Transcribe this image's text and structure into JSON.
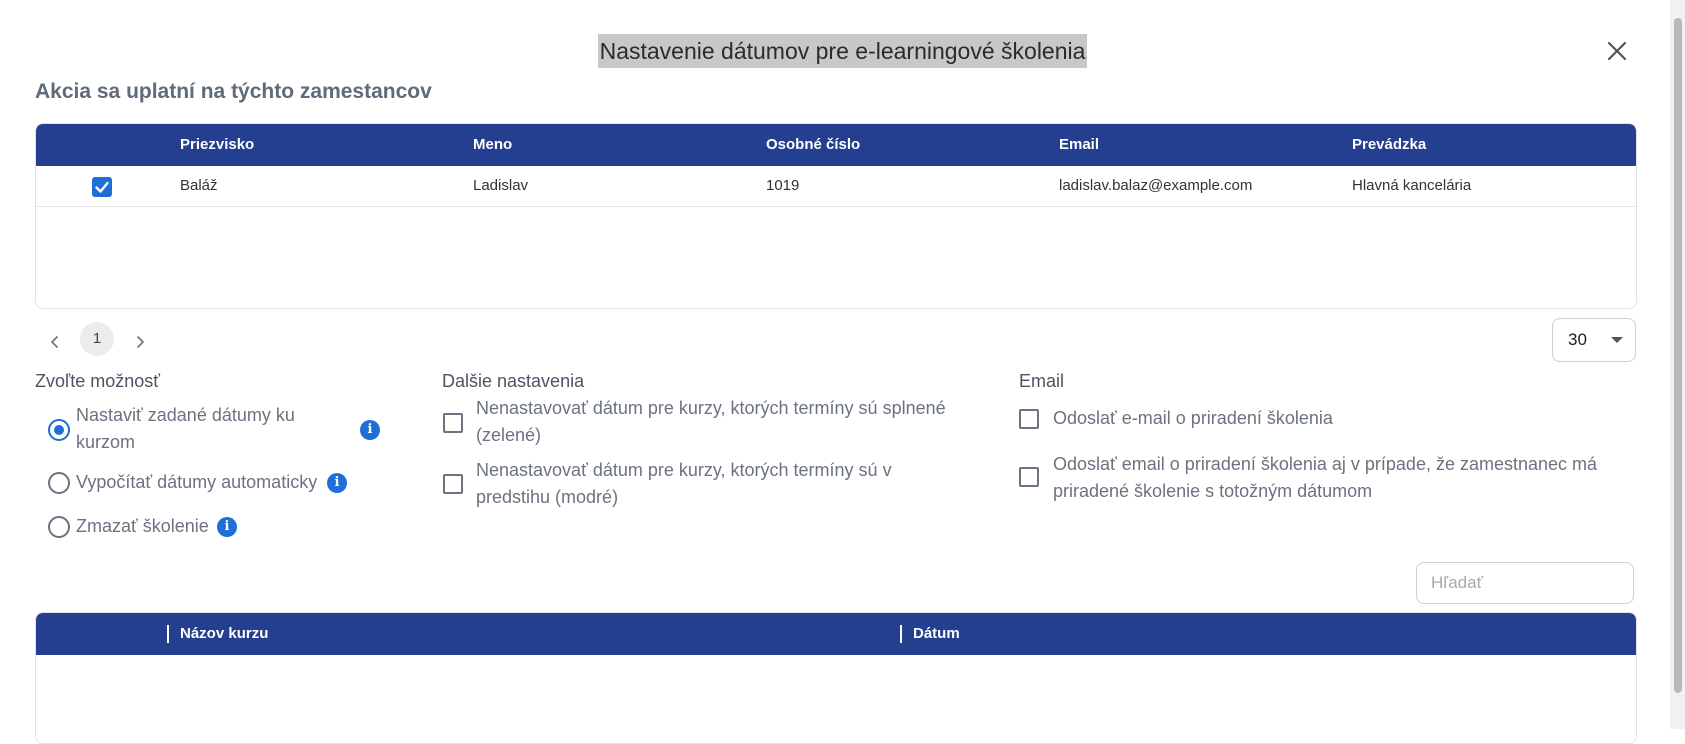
{
  "dialog": {
    "title": "Nastavenie dátumov pre e-learningové školenia",
    "subtitle": "Akcia sa uplatní na týchto zamestancov"
  },
  "employees": {
    "columns": [
      "Priezvisko",
      "Meno",
      "Osobné číslo",
      "Email",
      "Prevádzka"
    ],
    "rows": [
      {
        "checked": true,
        "surname": "Baláž",
        "name": "Ladislav",
        "personal_number": "1019",
        "email": "ladislav.balaz@example.com",
        "branch": "Hlavná kancelária"
      }
    ]
  },
  "pagination": {
    "current_page": "1",
    "page_size": "30"
  },
  "options": {
    "heading": "Zvoľte možnosť",
    "radios": [
      {
        "label": "Nastaviť zadané dátumy ku kurzom",
        "selected": true
      },
      {
        "label": "Vypočítať dátumy automaticky",
        "selected": false
      },
      {
        "label": "Zmazať školenie",
        "selected": false
      }
    ]
  },
  "other_settings": {
    "heading": "Dalšie nastavenia",
    "checkboxes": [
      {
        "label": "Nenastavovať dátum pre kurzy, ktorých termíny sú splnené (zelené)",
        "checked": false
      },
      {
        "label": "Nenastavovať dátum pre kurzy, ktorých termíny sú v predstihu (modré)",
        "checked": false
      }
    ]
  },
  "email_settings": {
    "heading": "Email",
    "checkboxes": [
      {
        "label": "Odoslať e-mail o priradení školenia",
        "checked": false
      },
      {
        "label": "Odoslať email o priradení školenia aj v prípade, že zamestnanec má priradené školenie s totožným dátumom",
        "checked": false
      }
    ]
  },
  "search": {
    "placeholder": "Hľadať",
    "value": ""
  },
  "courses": {
    "columns": [
      "Názov kurzu",
      "Dátum"
    ]
  },
  "icons": {
    "close": "close-icon",
    "info": "info-icon",
    "check": "check-icon",
    "prev": "chevron-left-icon",
    "next": "chevron-right-icon",
    "dropdown": "caret-down-icon"
  },
  "colors": {
    "header_bg": "#243f8f",
    "accent": "#1f6ed8"
  }
}
